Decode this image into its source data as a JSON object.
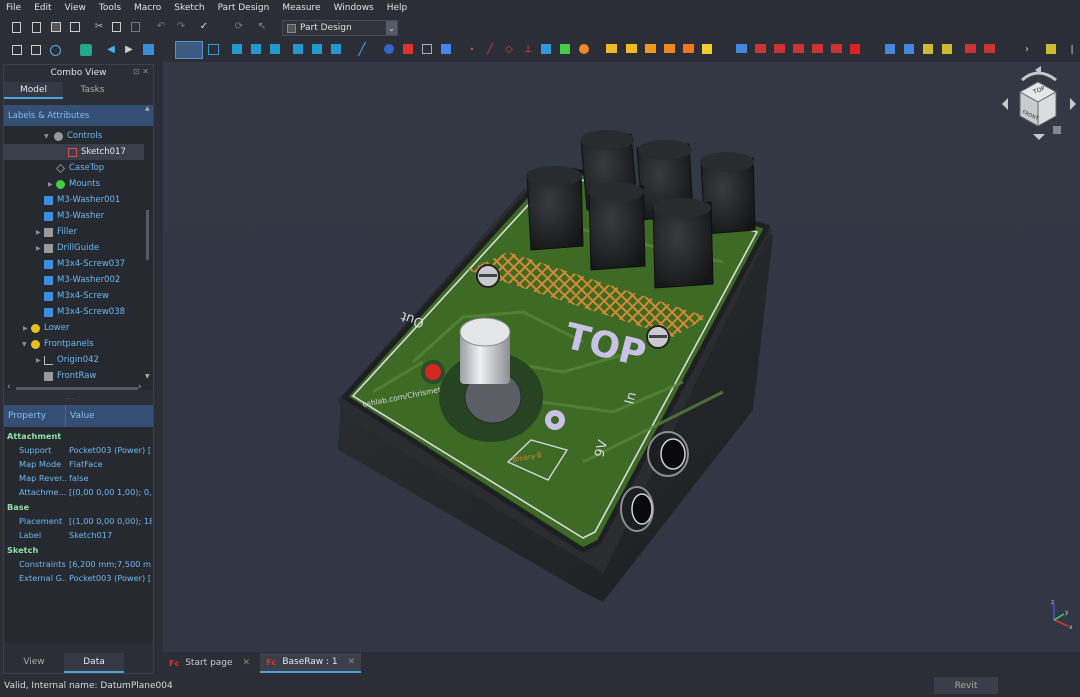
{
  "menu": [
    "File",
    "Edit",
    "View",
    "Tools",
    "Macro",
    "Sketch",
    "Part Design",
    "Measure",
    "Windows",
    "Help"
  ],
  "workbench": {
    "selected": "Part Design"
  },
  "combo": {
    "title": "Combo View",
    "tabs": [
      "Model",
      "Tasks"
    ],
    "tree_header": "Labels & Attributes",
    "tree_items": [
      {
        "label": "Controls",
        "icon": "folder-icon",
        "selected": false
      },
      {
        "label": "Sketch017",
        "icon": "sketch-icon",
        "selected": true
      },
      {
        "label": "CaseTop",
        "icon": "datum-plane-icon",
        "selected": false
      },
      {
        "label": "Mounts",
        "icon": "group-icon",
        "selected": false
      },
      {
        "label": "M3-Washer001",
        "icon": "body-icon",
        "selected": false
      },
      {
        "label": "M3-Washer",
        "icon": "body-icon",
        "selected": false
      },
      {
        "label": "Filler",
        "icon": "part-icon",
        "selected": false
      },
      {
        "label": "DrillGuide",
        "icon": "part-icon",
        "selected": false
      },
      {
        "label": "M3x4-Screw037",
        "icon": "body-icon",
        "selected": false
      },
      {
        "label": "M3-Washer002",
        "icon": "body-icon",
        "selected": false
      },
      {
        "label": "M3x4-Screw",
        "icon": "body-icon",
        "selected": false
      },
      {
        "label": "M3x4-Screw038",
        "icon": "body-icon",
        "selected": false
      },
      {
        "label": "Lower",
        "icon": "yellow-part-icon",
        "selected": false
      },
      {
        "label": "Frontpanels",
        "icon": "yellow-part-icon",
        "selected": false
      },
      {
        "label": "Origin042",
        "icon": "origin-icon",
        "selected": false
      },
      {
        "label": "FrontRaw",
        "icon": "part-icon",
        "selected": false
      }
    ],
    "properties": {
      "headers": [
        "Property",
        "Value"
      ],
      "rows": [
        {
          "group": "Attachment"
        },
        {
          "name": "Support",
          "value": "Pocket003 (Power) [..."
        },
        {
          "name": "Map Mode",
          "value": "FlatFace"
        },
        {
          "name": "Map Rever...",
          "value": "false"
        },
        {
          "name": "Attachme...",
          "value": "[(0,00 0,00 1,00); 0,0..."
        },
        {
          "group": "Base"
        },
        {
          "name": "Placement",
          "value": "[(1,00 0,00 0,00); 18..."
        },
        {
          "name": "Label",
          "value": "Sketch017"
        },
        {
          "group": "Sketch"
        },
        {
          "name": "Constraints",
          "value": "[6,200 mm;7,500 m..."
        },
        {
          "name": "External G...",
          "value": "Pocket003 (Power) [..."
        }
      ]
    },
    "bottom_tabs": [
      "View",
      "Data"
    ]
  },
  "pcb_text": {
    "title": "TOP",
    "out": "Out",
    "in": "In",
    "nine_v": "9V",
    "url": "oshlab.com/Chrismettal/pedaldev",
    "logo": "Binary-8"
  },
  "navcube_face": {
    "top": "TOP",
    "front": "FRONT"
  },
  "axis": {
    "x": "x",
    "y": "y",
    "z": "z"
  },
  "doc_tabs": [
    {
      "label": "Start page",
      "active": false
    },
    {
      "label": "BaseRaw : 1",
      "active": true
    }
  ],
  "status": {
    "message": "Valid, Internal name: DatumPlane004",
    "revit": "Revit"
  }
}
